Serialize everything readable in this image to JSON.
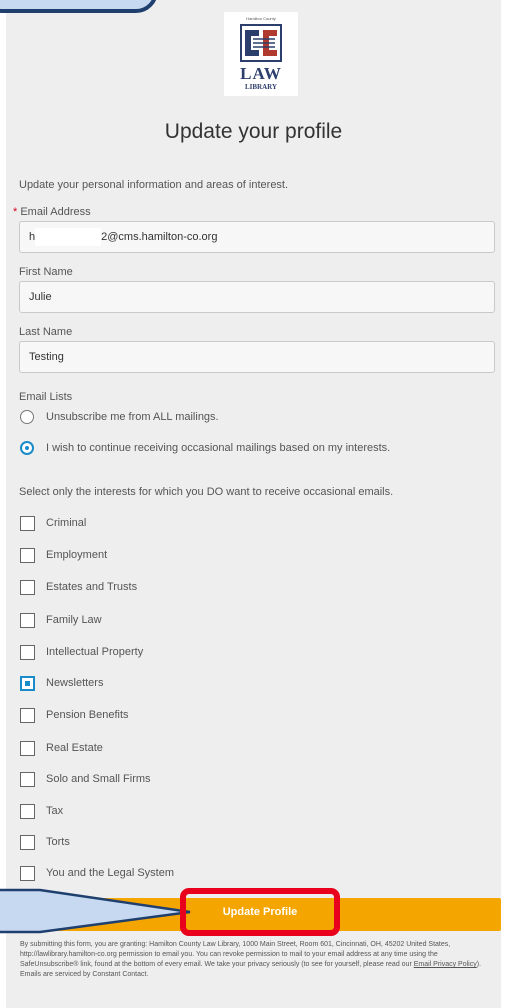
{
  "header": {
    "title": "Update your profile"
  },
  "logo": {
    "small_text": "Hamilton County",
    "main": "LAW",
    "sub": "LIBRARY"
  },
  "intro": "Update your personal information and areas of interest.",
  "email": {
    "required_mark": "*",
    "label": "Email Address",
    "value_prefix": "h",
    "value_suffix": "2@cms.hamilton-co.org"
  },
  "first_name": {
    "label": "First Name",
    "value": "Julie"
  },
  "last_name": {
    "label": "Last Name",
    "value": "Testing"
  },
  "email_lists": {
    "label": "Email Lists",
    "options": [
      {
        "label": "Unsubscribe me from ALL mailings.",
        "selected": false
      },
      {
        "label": "I wish to continue receiving occasional mailings based on my interests.",
        "selected": true
      }
    ]
  },
  "interests": {
    "prompt": "Select only the interests for which you DO want to receive occasional emails.",
    "items": [
      {
        "label": "Criminal",
        "checked": false
      },
      {
        "label": "Employment",
        "checked": false
      },
      {
        "label": "Estates and Trusts",
        "checked": false
      },
      {
        "label": "Family Law",
        "checked": false
      },
      {
        "label": "Intellectual Property",
        "checked": false
      },
      {
        "label": "Newsletters",
        "checked": true
      },
      {
        "label": "Pension Benefits",
        "checked": false
      },
      {
        "label": "Real Estate",
        "checked": false
      },
      {
        "label": "Solo and Small Firms",
        "checked": false
      },
      {
        "label": "Tax",
        "checked": false
      },
      {
        "label": "Torts",
        "checked": false
      },
      {
        "label": "You and the Legal System",
        "checked": false
      }
    ]
  },
  "submit": {
    "label": "Update Profile"
  },
  "footer": {
    "text_before": "By submitting this form, you are granting: Hamilton County Law Library, 1000 Main Street, Room 601, Cincinnati, OH, 45202 United States, http://lawlibrary.hamilton-co.org permission to email you. You can revoke permission to mail to your email address at any time using the SafeUnsubscribe® link, found at the bottom of every email. We take your privacy seriously (to see for yourself, please read our ",
    "link": "Email Privacy Policy",
    "text_after": "). Emails are serviced by Constant Contact."
  },
  "colors": {
    "accent": "#1a8bc9",
    "button": "#f5a500",
    "highlight": "#e8001c",
    "callout": "#c6d9f1"
  }
}
